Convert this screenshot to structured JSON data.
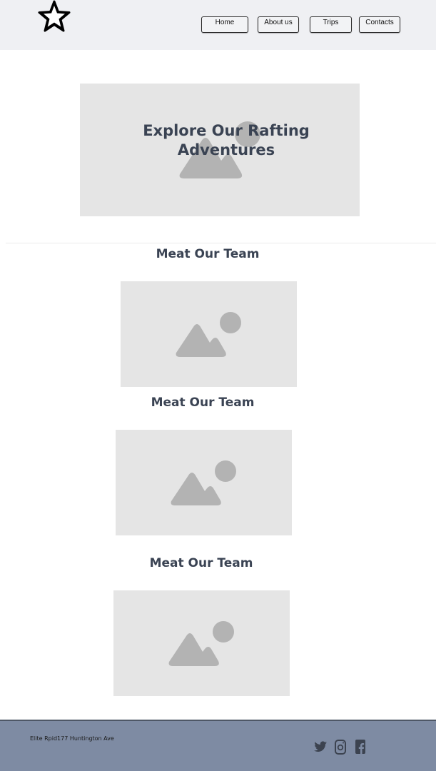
{
  "header": {
    "logo_icon": "star-logo-icon",
    "nav": [
      {
        "label": "Home"
      },
      {
        "label": "About us"
      },
      {
        "label": "Trips"
      },
      {
        "label": "Contacts"
      }
    ]
  },
  "hero": {
    "title": "Explore Our Rafting Adventures",
    "image_icon": "image-placeholder-icon"
  },
  "team": [
    {
      "title": "Meat Our Team",
      "image_icon": "image-placeholder-icon"
    },
    {
      "title": "Meat Our Team",
      "image_icon": "image-placeholder-icon"
    },
    {
      "title": "Meat Our Team",
      "image_icon": "image-placeholder-icon"
    }
  ],
  "footer": {
    "address": "Elite Rpid177 Huntington Ave",
    "social": [
      "twitter-icon",
      "instagram-icon",
      "facebook-icon"
    ]
  },
  "colors": {
    "header_bg": "#eff0f3",
    "footer_bg": "#7e8ba3",
    "heading_text": "#3a4353",
    "placeholder_bg": "#e5e5e5",
    "placeholder_shape": "#b3b3b3"
  }
}
